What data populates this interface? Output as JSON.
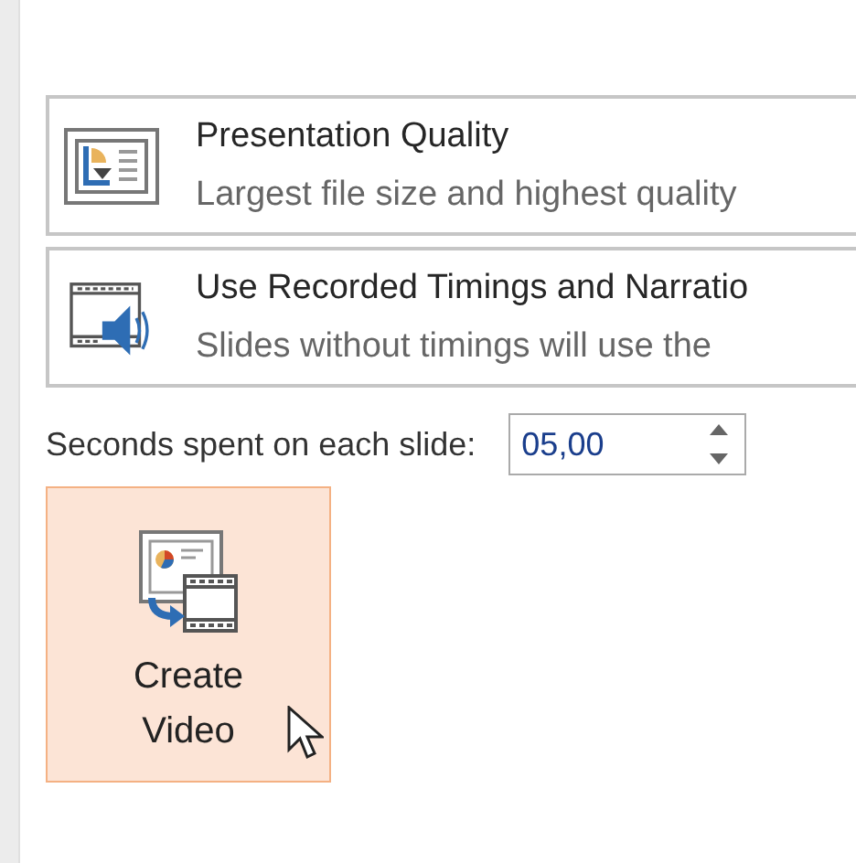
{
  "dropdowns": [
    {
      "kind": "quality",
      "title": "Presentation Quality",
      "description": "Largest file size and highest quality"
    },
    {
      "kind": "timings",
      "title": "Use Recorded Timings and Narratio",
      "description": "Slides without timings will use the"
    }
  ],
  "seconds": {
    "label": "Seconds spent on each slide:",
    "value": "05,00"
  },
  "create_button": {
    "label_lines": [
      "Create",
      "Video"
    ],
    "hovered": true
  }
}
